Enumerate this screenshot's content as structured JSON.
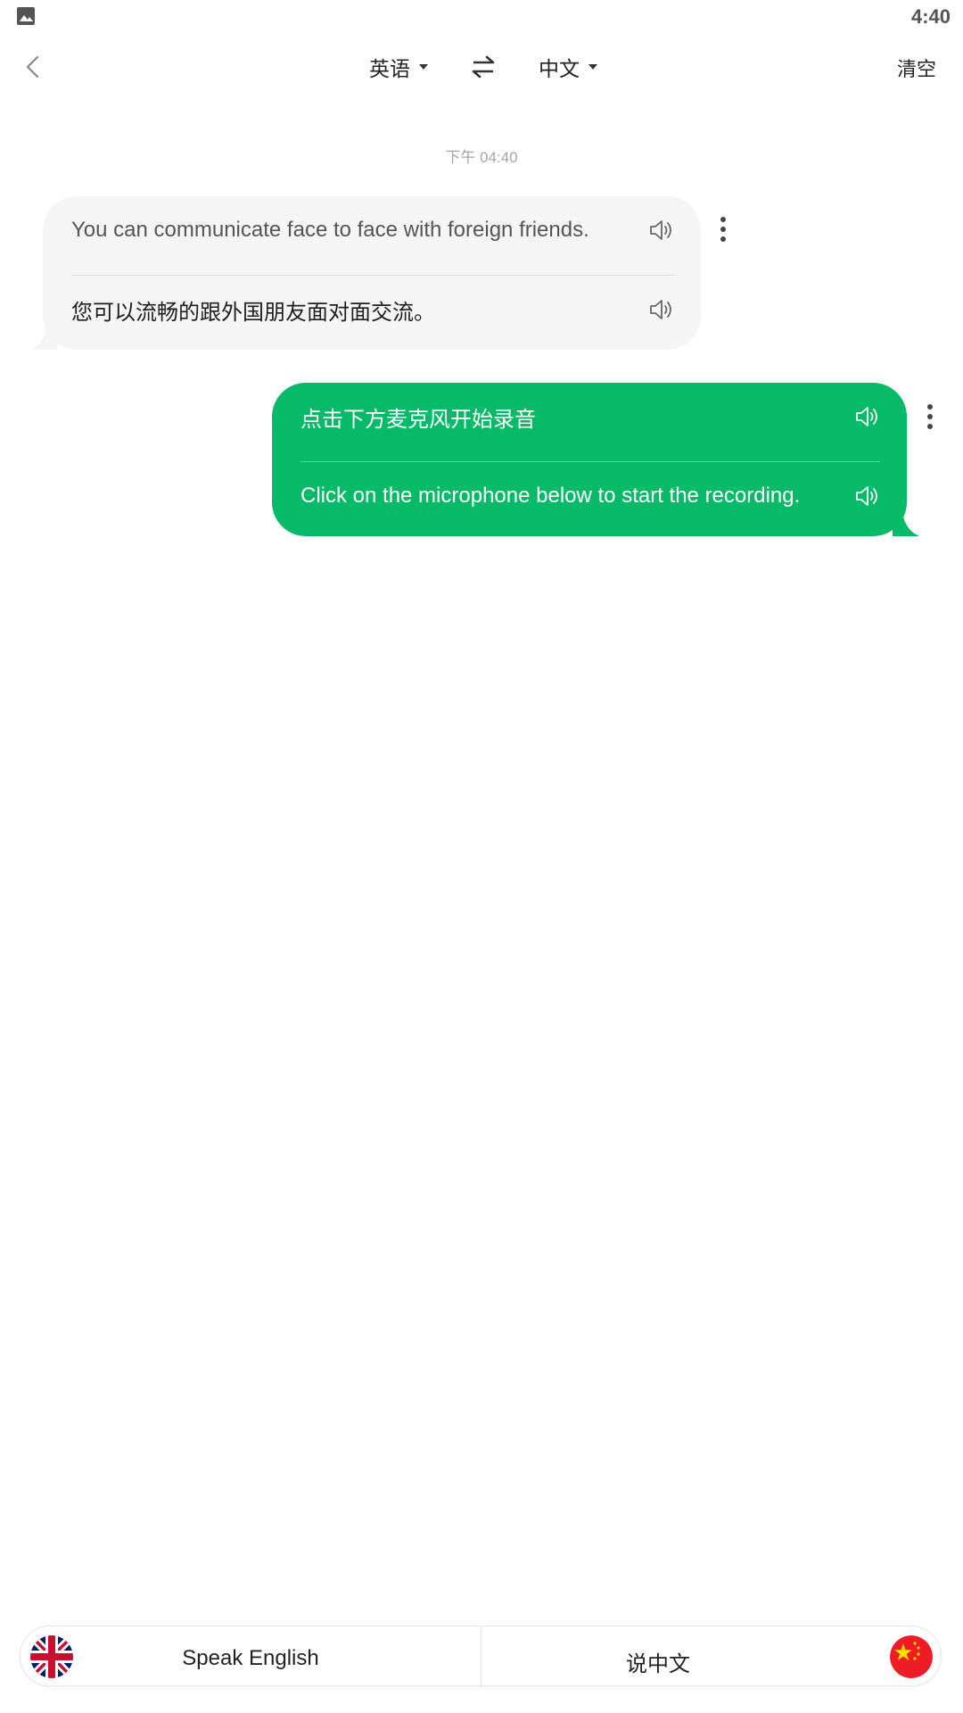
{
  "status_bar": {
    "time": "4:40"
  },
  "topbar": {
    "source_language": "英语",
    "target_language": "中文",
    "clear_label": "清空"
  },
  "conversation": {
    "timestamp": "下午 04:40",
    "messages": [
      {
        "side": "left",
        "original": "You can communicate face to face with foreign friends.",
        "translation": "您可以流畅的跟外国朋友面对面交流。"
      },
      {
        "side": "right",
        "original": "点击下方麦克风开始录音",
        "translation": "Click on the microphone below to start the recording."
      }
    ]
  },
  "bottom_bar": {
    "speak_english_label": "Speak English",
    "speak_chinese_label": "说中文"
  },
  "colors": {
    "accent_green": "#07ba68",
    "left_bubble_bg": "#f5f5f5",
    "timestamp_gray": "#a6a6a6"
  },
  "icons": [
    "gallery-icon",
    "back-arrow-icon",
    "caret-down-icon",
    "swap-icon",
    "speaker-icon",
    "more-vertical-icon",
    "uk-flag-icon",
    "china-flag-icon"
  ]
}
